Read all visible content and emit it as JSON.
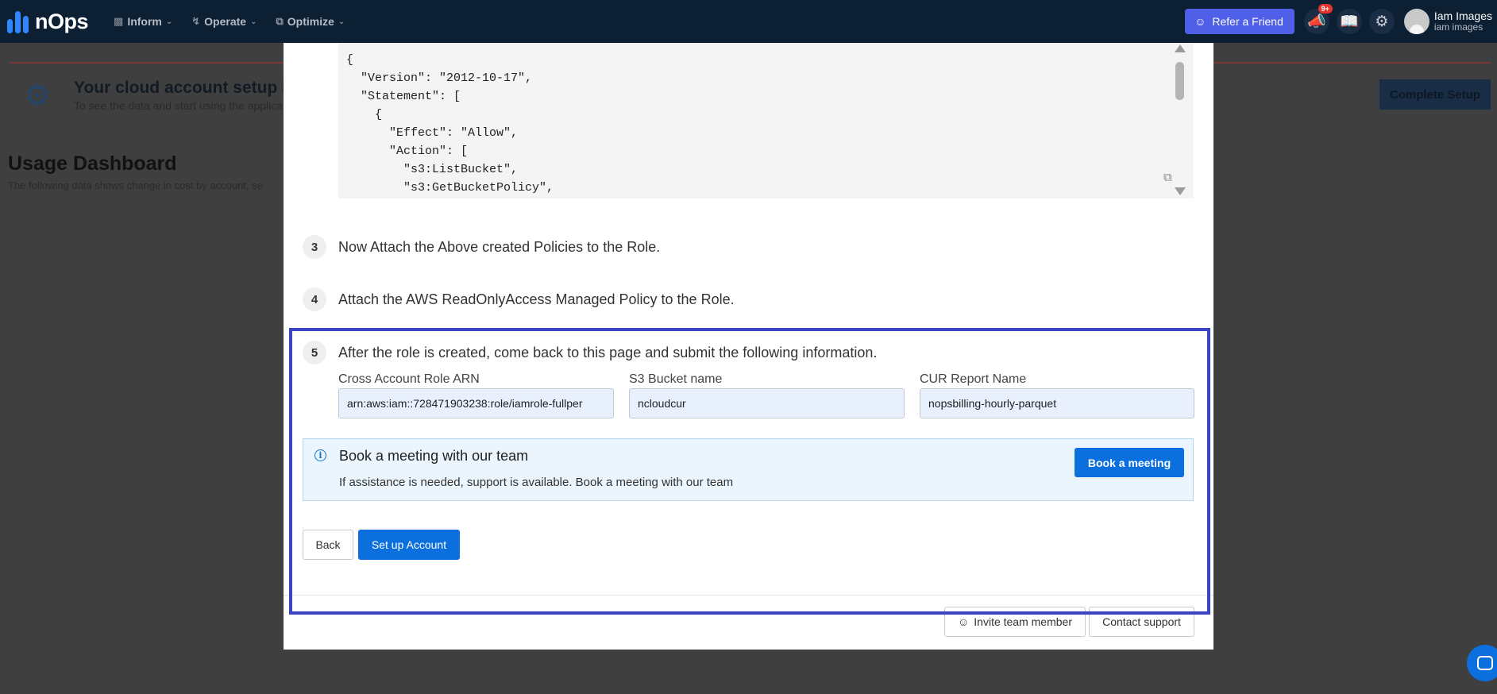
{
  "nav": {
    "logo": "nOps",
    "menu": [
      {
        "label": "Inform",
        "icon": "chart-icon"
      },
      {
        "label": "Operate",
        "icon": "bolt-icon"
      },
      {
        "label": "Optimize",
        "icon": "layers-icon"
      }
    ],
    "refer_label": "Refer a Friend",
    "notification_badge": "9+",
    "user_name": "Iam Images",
    "user_sub": "iam images"
  },
  "background": {
    "banner_title": "Your cloud account setup is",
    "banner_sub": "To see the data and start using the applica",
    "complete_setup_label": "Complete Setup",
    "usage_title": "Usage Dashboard",
    "usage_sub": "The following data shows change in cost by account, se"
  },
  "code": {
    "lines": [
      "{",
      "  \"Version\": \"2012-10-17\",",
      "  \"Statement\": [",
      "    {",
      "      \"Effect\": \"Allow\",",
      "      \"Action\": [",
      "        \"s3:ListBucket\",",
      "        \"s3:GetBucketPolicy\","
    ]
  },
  "steps": {
    "s3": {
      "num": "3",
      "text": "Now Attach the Above created Policies to the Role."
    },
    "s4": {
      "num": "4",
      "text": "Attach the AWS ReadOnlyAccess Managed Policy to the Role."
    },
    "s5": {
      "num": "5",
      "text": "After the role is created, come back to this page and submit the following information."
    }
  },
  "form": {
    "arn_label": "Cross Account Role ARN",
    "arn_value": "arn:aws:iam::728471903238:role/iamrole-fullper",
    "bucket_label": "S3 Bucket name",
    "bucket_value": "ncloudcur",
    "cur_label": "CUR Report Name",
    "cur_value": "nopsbilling-hourly-parquet"
  },
  "meeting": {
    "title": "Book a meeting with our team",
    "subtitle": "If assistance is needed, support is available. Book a meeting with our team",
    "button": "Book a meeting"
  },
  "actions": {
    "back": "Back",
    "setup": "Set up Account",
    "invite": "Invite team member",
    "contact": "Contact support"
  },
  "colors": {
    "nav_bg": "#0d1f33",
    "primary": "#0b6fde",
    "refer": "#4f5fe8",
    "highlight": "#3c44c3"
  }
}
